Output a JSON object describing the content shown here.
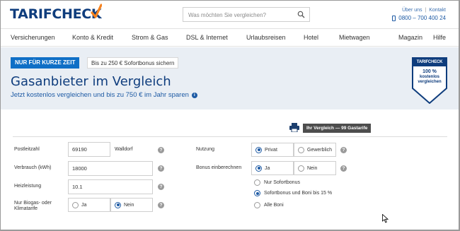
{
  "header": {
    "logo_text": "TARIFCHECK",
    "search_placeholder": "Was möchten Sie vergleichen?",
    "link_about": "Über uns",
    "link_sep": "|",
    "link_contact": "Kontakt",
    "phone": "0800 – 700 400 24"
  },
  "nav": {
    "items": [
      "Versicherungen",
      "Konto & Kredit",
      "Strom & Gas",
      "DSL & Internet",
      "Urlaubsreisen",
      "Hotel",
      "Mietwagen",
      "Magazin",
      "Hilfe"
    ]
  },
  "banner": {
    "badge_short": "NUR FÜR KURZE ZEIT",
    "badge_bonus": "Bis zu 250 € Sofortbonus sichern",
    "title": "Gasanbieter im Vergleich",
    "subtitle": "Jetzt kostenlos vergleichen und bis zu 750 € im Jahr sparen",
    "seal": {
      "logo": "TARIFCHECK",
      "line1": "100 %",
      "line2": "kostenlos",
      "line3": "vergleichen"
    }
  },
  "compare_badge": "Ihr Vergleich — 99 Gastarife",
  "form": {
    "postcode_label": "Postleitzahl",
    "postcode_value": "69190",
    "city": "Walldorf",
    "consumption_label": "Verbrauch (kWh)",
    "consumption_value": "18000",
    "heating_label": "Heizleistung",
    "heating_value": "10.1",
    "biogas_label_1": "Nur Biogas- oder",
    "biogas_label_2": "Klimatarife",
    "biogas_yes": "Ja",
    "biogas_no": "Nein",
    "usage_label": "Nutzung",
    "usage_private": "Privat",
    "usage_commercial": "Gewerblich",
    "bonus_label": "Bonus einberechnen",
    "bonus_yes": "Ja",
    "bonus_no": "Nein",
    "bonus_options": [
      "Nur Sofortbonus",
      "Sofortbonus und Boni bis 15 %",
      "Alle Boni"
    ],
    "help_glyph": "?",
    "info_glyph": "i"
  },
  "colors": {
    "brand_dark": "#0f3d7d",
    "brand_blue": "#1d5aa4",
    "badge_blue": "#0f6fc6",
    "check_orange": "#f5821f",
    "banner_bg": "#e9eef4"
  }
}
